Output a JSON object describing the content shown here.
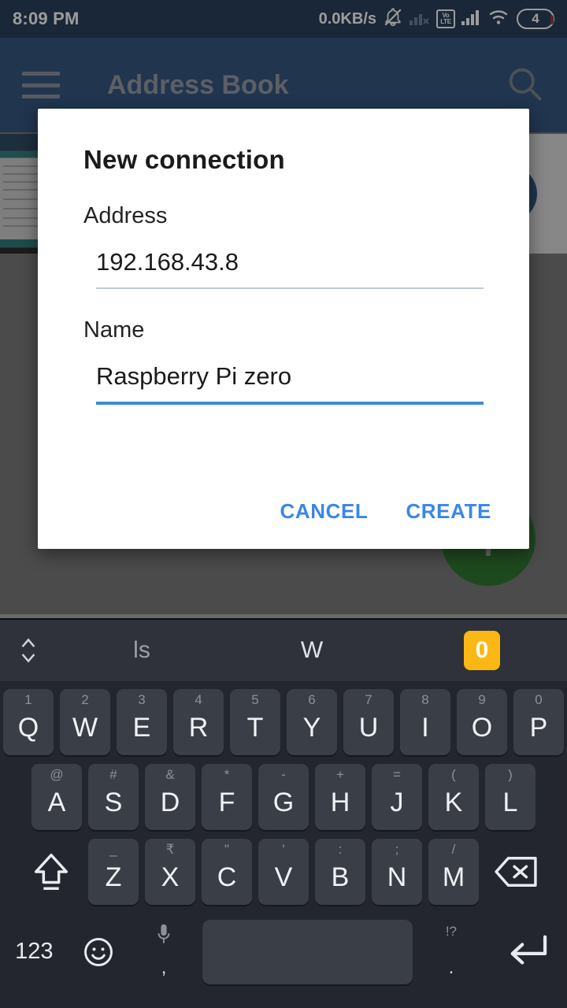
{
  "status_bar": {
    "time": "8:09 PM",
    "network_speed": "0.0KB/s",
    "icons": [
      "bell-muted-icon",
      "signal-no-service-icon",
      "volte-badge-icon",
      "signal-bars-icon",
      "wifi-icon"
    ],
    "volte_top": "Vo",
    "volte_bottom": "LTE",
    "battery_level": "4"
  },
  "app_bar": {
    "title": "Address Book",
    "menu_icon": "hamburger-menu-icon",
    "search_icon": "search-icon"
  },
  "dialog": {
    "title": "New connection",
    "fields": [
      {
        "label": "Address",
        "value": "192.168.43.8",
        "focused": false
      },
      {
        "label": "Name",
        "value": "Raspberry Pi zero",
        "focused": true
      }
    ],
    "cancel_label": "CANCEL",
    "create_label": "CREATE",
    "action_color": "#3b86e8",
    "focus_underline_color": "#3d8cd4",
    "idle_underline_color": "#b9ccd6"
  },
  "fab": {
    "icon": "plus-icon",
    "color": "#176617"
  },
  "keyboard": {
    "suggestions": {
      "expand_icon": "chevron-up-down-icon",
      "items": [
        "ls",
        "W"
      ],
      "badge": "0",
      "badge_color": "#fbb713"
    },
    "row1": [
      {
        "hint": "1",
        "main": "Q"
      },
      {
        "hint": "2",
        "main": "W"
      },
      {
        "hint": "3",
        "main": "E"
      },
      {
        "hint": "4",
        "main": "R"
      },
      {
        "hint": "5",
        "main": "T"
      },
      {
        "hint": "6",
        "main": "Y"
      },
      {
        "hint": "7",
        "main": "U"
      },
      {
        "hint": "8",
        "main": "I"
      },
      {
        "hint": "9",
        "main": "O"
      },
      {
        "hint": "0",
        "main": "P"
      }
    ],
    "row2": [
      {
        "hint": "@",
        "main": "A"
      },
      {
        "hint": "#",
        "main": "S"
      },
      {
        "hint": "&",
        "main": "D"
      },
      {
        "hint": "*",
        "main": "F"
      },
      {
        "hint": "-",
        "main": "G"
      },
      {
        "hint": "+",
        "main": "H"
      },
      {
        "hint": "=",
        "main": "J"
      },
      {
        "hint": "(",
        "main": "K"
      },
      {
        "hint": ")",
        "main": "L"
      }
    ],
    "row3": [
      {
        "hint": "_",
        "main": "Z"
      },
      {
        "hint": "₹",
        "main": "X"
      },
      {
        "hint": "\"",
        "main": "C"
      },
      {
        "hint": "'",
        "main": "V"
      },
      {
        "hint": ":",
        "main": "B"
      },
      {
        "hint": ";",
        "main": "N"
      },
      {
        "hint": "/",
        "main": "M"
      }
    ],
    "shift_icon": "shift-icon",
    "backspace_icon": "backspace-icon",
    "row4": {
      "numeric_label": "123",
      "emoji_icon": "emoji-smiley-icon",
      "mic_icon": "microphone-icon",
      "mic_sub": ",",
      "space_label": "",
      "period_main": ".",
      "period_hint": "!?",
      "enter_icon": "enter-return-icon"
    }
  }
}
